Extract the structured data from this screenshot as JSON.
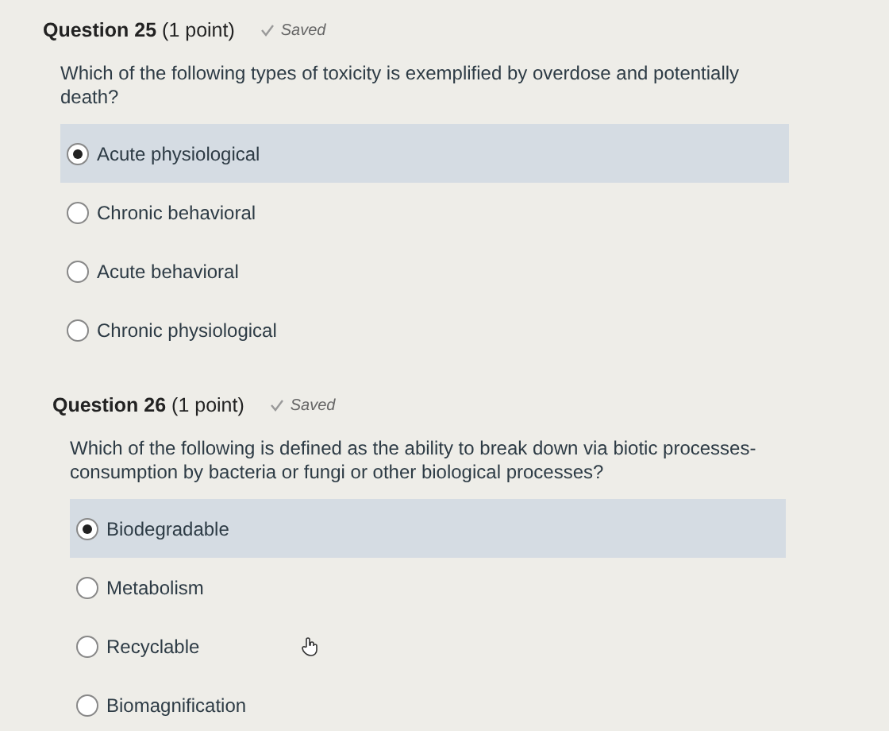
{
  "questions": [
    {
      "number": "Question 25",
      "points": "(1 point)",
      "status": "Saved",
      "text": "Which of the following types of toxicity is exemplified by overdose and potentially death?",
      "options": [
        {
          "label": "Acute physiological",
          "selected": true
        },
        {
          "label": "Chronic behavioral",
          "selected": false
        },
        {
          "label": "Acute behavioral",
          "selected": false
        },
        {
          "label": "Chronic physiological",
          "selected": false
        }
      ]
    },
    {
      "number": "Question 26",
      "points": "(1 point)",
      "status": "Saved",
      "text": "Which of the following is defined as the ability to break down via biotic processes-consumption by bacteria or fungi or other biological processes?",
      "options": [
        {
          "label": "Biodegradable",
          "selected": true
        },
        {
          "label": "Metabolism",
          "selected": false
        },
        {
          "label": "Recyclable",
          "selected": false
        },
        {
          "label": "Biomagnification",
          "selected": false
        }
      ]
    }
  ]
}
